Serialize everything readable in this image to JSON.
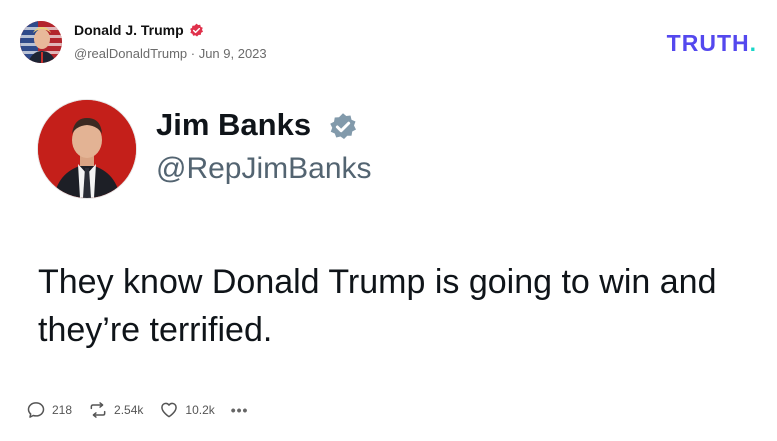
{
  "post": {
    "author_name": "Donald J. Trump",
    "author_meta": "@realDonaldTrump · Jun 9, 2023",
    "brand_logo": "TRUTH",
    "brand_dot": ".",
    "quoted": {
      "name": "Jim Banks",
      "handle": "@RepJimBanks",
      "text": "They know Donald Trump is going to win and they’re terrified."
    },
    "actions": {
      "replies": "218",
      "retruths": "2.54k",
      "likes": "10.2k",
      "more": "•••"
    }
  },
  "icons": {
    "verified_small": "verified-badge-icon",
    "verified_large": "verified-badge-icon",
    "reply": "speech-bubble-icon",
    "retruth": "repost-arrows-icon",
    "like": "heart-icon",
    "more": "ellipsis-icon"
  },
  "colors": {
    "brand": "#5448ee",
    "brand_accent": "#17d6c8",
    "verified_small": "#e0314b",
    "verified_large": "#829aab"
  }
}
